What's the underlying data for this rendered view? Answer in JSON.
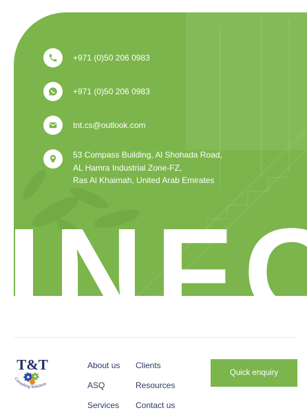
{
  "colors": {
    "accent": "#7bb54b",
    "link": "#2c3a63",
    "divider": "#ebebeb",
    "on_accent": "#ffffff"
  },
  "contact": {
    "phone": {
      "icon": "phone-icon",
      "text": "+971 (0)50 206 0983"
    },
    "whatsapp": {
      "icon": "whatsapp-icon",
      "text": "+971 (0)50 206 0983"
    },
    "email": {
      "icon": "mail-icon",
      "text": "tnt.cs@outlook.com"
    },
    "address": {
      "icon": "location-pin-icon",
      "lines": [
        "53 Compass Building, Al Shohada Road,",
        "AL Hamra Industrial Zone-FZ,",
        "Ras Al Khaimah, United Arab Emirates"
      ]
    }
  },
  "banner": {
    "heading": "INFO"
  },
  "footer": {
    "logo": {
      "mark": "T&T",
      "tagline": "Consulting Solutions"
    },
    "nav_col1": [
      "About us",
      "ASQ",
      "Services"
    ],
    "nav_col2": [
      "Clients",
      "Resources",
      "Contact us"
    ],
    "cta_label": "Quick enquiry"
  }
}
